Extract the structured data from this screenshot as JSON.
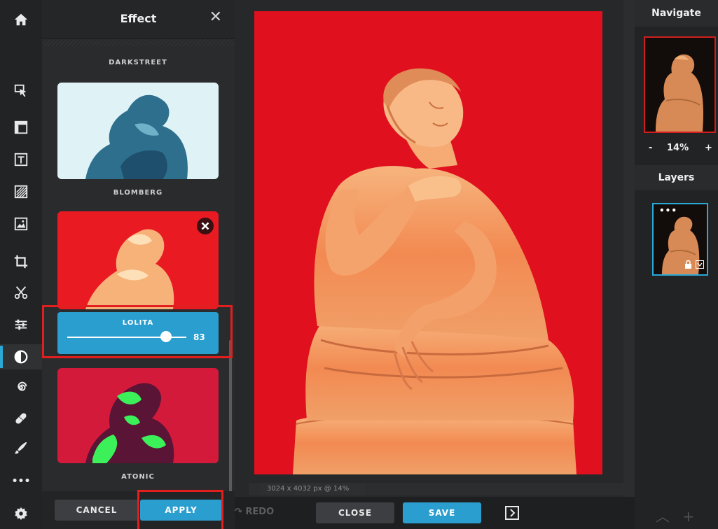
{
  "toolbar": {
    "items": [
      {
        "name": "home-icon",
        "active": false
      },
      {
        "name": "select-icon",
        "active": false
      },
      {
        "name": "layout-icon",
        "active": false
      },
      {
        "name": "text-icon",
        "active": false
      },
      {
        "name": "pattern-icon",
        "active": false
      },
      {
        "name": "image-icon",
        "active": false
      },
      {
        "name": "crop-icon",
        "active": false
      },
      {
        "name": "cut-icon",
        "active": false
      },
      {
        "name": "adjust-icon",
        "active": false
      },
      {
        "name": "effect-icon",
        "active": true
      },
      {
        "name": "liquify-icon",
        "active": false
      },
      {
        "name": "heal-icon",
        "active": false
      },
      {
        "name": "brush-icon",
        "active": false
      },
      {
        "name": "more-icon",
        "active": false
      },
      {
        "name": "settings-icon",
        "active": false
      }
    ],
    "more_label": "•••"
  },
  "panel": {
    "title": "Effect",
    "close": "✕",
    "effects": [
      {
        "name": "DARKSTREET"
      },
      {
        "name": "BLOMBERG"
      },
      {
        "name": "LOLITA",
        "selected": true
      },
      {
        "name": "ATONIC"
      }
    ],
    "slider": {
      "label": "LOLITA",
      "value": "83",
      "fraction": 0.83
    },
    "cancel": "CANCEL",
    "apply": "APPLY"
  },
  "canvas": {
    "status": "3024 x 4032 px @ 14%"
  },
  "bottom": {
    "redo": "↷ REDO",
    "close": "CLOSE",
    "save": "SAVE"
  },
  "navigate": {
    "title": "Navigate",
    "zoom_minus": "-",
    "zoom_value": "14%",
    "zoom_plus": "+"
  },
  "layers": {
    "title": "Layers",
    "dots": "•••"
  },
  "right_bottom": {
    "symbols": "︿ + ﹀"
  },
  "colors": {
    "accent": "#2a9ecf",
    "highlight": "#e21f1f",
    "image_red": "#e0101e"
  }
}
